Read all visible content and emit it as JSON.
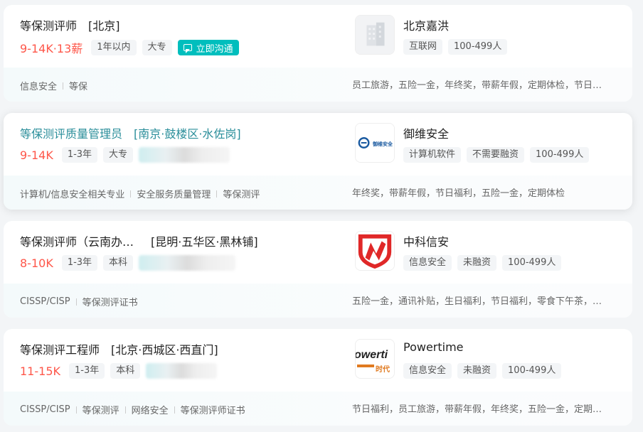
{
  "jobs": [
    {
      "title": "等保测评师",
      "location": "[北京]",
      "salary": "9-14K·13薪",
      "tags": [
        "1年以内",
        "大专"
      ],
      "chat_label": "立即沟通",
      "skills": [
        "信息安全",
        "等保"
      ],
      "company": {
        "name": "北京嘉洪",
        "tags": [
          "互联网",
          "100-499人"
        ],
        "logo": "building-icon"
      },
      "welfare": "员工旅游，五险一金，年终奖，带薪年假，定期体检，节日福利"
    },
    {
      "title": "等保测评质量管理员",
      "location": "[南京·鼓楼区·水佐岗]",
      "salary": "9-14K",
      "tags": [
        "1-3年",
        "大专"
      ],
      "skills": [
        "计算机/信息安全相关专业",
        "安全服务质量管理",
        "等保测评"
      ],
      "company": {
        "name": "御维安全",
        "tags": [
          "计算机软件",
          "不需要融资",
          "100-499人"
        ],
        "logo": "yuwei-logo",
        "logo_text": "御维安全"
      },
      "welfare": "年终奖，带薪年假，节日福利，五险一金，定期体检"
    },
    {
      "title": "等保测评师（云南办事处）",
      "location": "[昆明·五华区·黑林铺]",
      "salary": "8-10K",
      "tags": [
        "1-3年",
        "本科"
      ],
      "skills": [
        "CISSP/CISP",
        "等保测评证书"
      ],
      "company": {
        "name": "中科信安",
        "tags": [
          "信息安全",
          "未融资",
          "100-499人"
        ],
        "logo": "shield-n-logo"
      },
      "welfare": "五险一金，通讯补贴，生日福利，节日福利，零食下午茶，带薪年假"
    },
    {
      "title": "等保测评工程师",
      "location": "[北京·西城区·西直门]",
      "salary": "11-15K",
      "tags": [
        "1-3年",
        "本科"
      ],
      "skills": [
        "CISSP/CISP",
        "等保测评",
        "网络安全",
        "等保测评师证书"
      ],
      "company": {
        "name": "Powertime",
        "tags": [
          "信息安全",
          "未融资",
          "100-499人"
        ],
        "logo": "powertime-logo",
        "logo_text": "owerti",
        "logo_subtext": "时代"
      },
      "welfare": "节日福利，员工旅游，带薪年假，年终奖，五险一金，定期体检"
    }
  ],
  "colors": {
    "salary": "#fe574a",
    "accent": "#00bebd",
    "active_title": "#2a8e9a"
  }
}
